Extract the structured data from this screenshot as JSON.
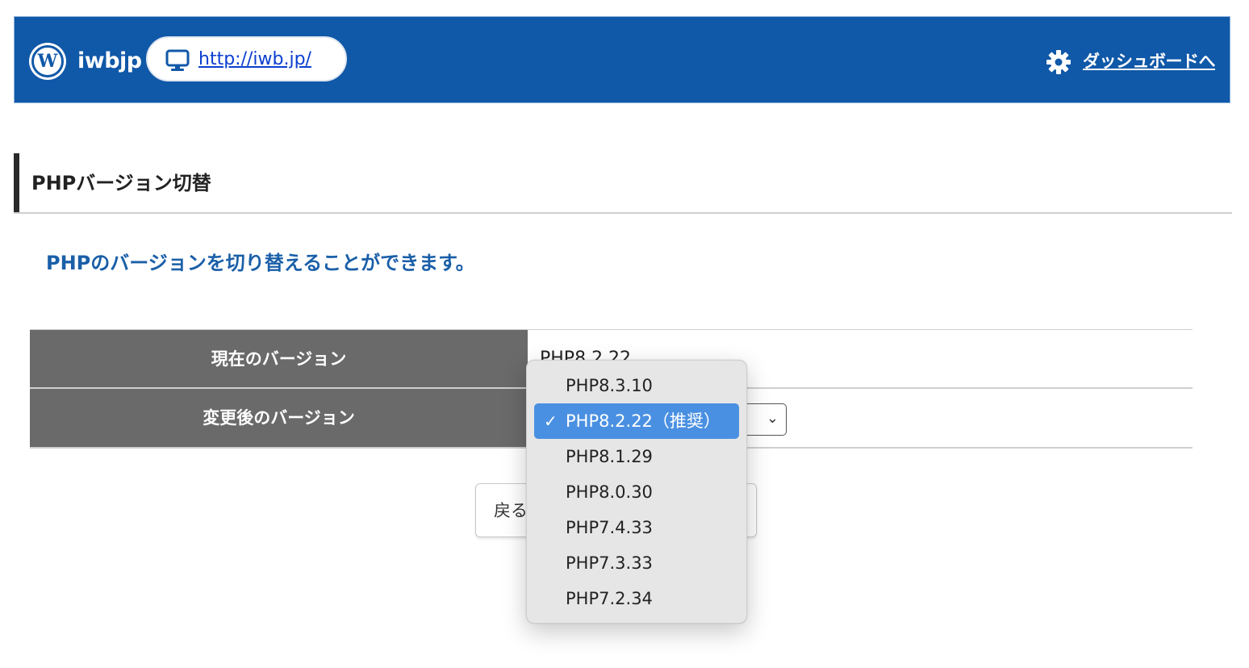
{
  "header": {
    "site_name": "iwbjp",
    "site_url": "http://iwb.jp/",
    "dashboard_link": "ダッシュボードへ",
    "logo_letter": "W",
    "icons": {
      "logo": "wordpress-logo-icon",
      "monitor": "monitor-icon",
      "gear": "gear-icon"
    },
    "colors": {
      "header_bg": "#1058a8",
      "link": "#0b3fd0"
    }
  },
  "page": {
    "title": "PHPバージョン切替",
    "description": "PHPのバージョンを切り替えることができます。"
  },
  "table": {
    "current_label": "現在のバージョン",
    "current_value": "PHP8.2.22",
    "new_label": "変更後のバージョン"
  },
  "buttons": {
    "back": "戻る"
  },
  "dropdown": {
    "options": [
      {
        "label": "PHP8.3.10",
        "selected": false
      },
      {
        "label": "PHP8.2.22（推奨）",
        "selected": true
      },
      {
        "label": "PHP8.1.29",
        "selected": false
      },
      {
        "label": "PHP8.0.30",
        "selected": false
      },
      {
        "label": "PHP7.4.33",
        "selected": false
      },
      {
        "label": "PHP7.3.33",
        "selected": false
      },
      {
        "label": "PHP7.2.34",
        "selected": false
      }
    ],
    "check_mark": "✓",
    "selected_color": "#4a90e2"
  }
}
